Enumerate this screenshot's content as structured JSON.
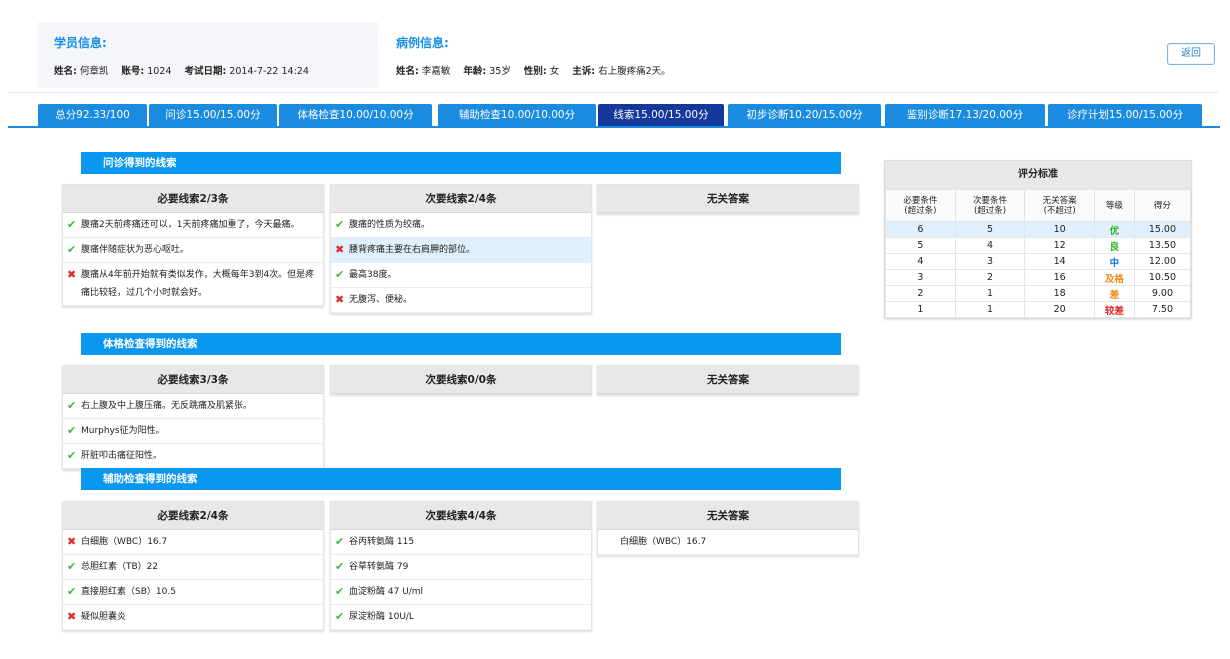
{
  "student": {
    "title": "学员信息:",
    "name_label": "姓名:",
    "name": "何章凯",
    "id_label": "账号:",
    "id": "1024",
    "date_label": "考试日期:",
    "date": "2014-7-22 14:24"
  },
  "case": {
    "title": "病例信息:",
    "name_label": "姓名:",
    "name": "李嘉敏",
    "age_label": "年龄:",
    "age": "35岁",
    "sex_label": "性别:",
    "sex": "女",
    "complaint_label": "主诉:",
    "complaint": "右上腹疼痛2天。"
  },
  "back_label": "返回",
  "tabs": [
    {
      "label": "总分92.33/100"
    },
    {
      "label": "问诊15.00/15.00分"
    },
    {
      "label": "体格检查10.00/10.00分"
    },
    {
      "label": "辅助检查10.00/10.00分"
    },
    {
      "label": "线索15.00/15.00分"
    },
    {
      "label": "初步诊断10.20/15.00分"
    },
    {
      "label": "鉴别诊断17.13/20.00分"
    },
    {
      "label": "诊疗计划15.00/15.00分"
    }
  ],
  "active_tab": 4,
  "sections": [
    {
      "title": "问诊得到的线索",
      "columns": [
        {
          "header": "必要线索2/3条",
          "rows": [
            {
              "text": "腹痛2天前疼痛还可以，1天前疼痛加重了，今天最痛。",
              "status": "ok"
            },
            {
              "text": "腹痛伴随症状为恶心呕吐。",
              "status": "ok"
            },
            {
              "text": "腹痛从4年前开始就有类似发作，大概每年3到4次。但是疼痛比较轻，过几个小时就会好。",
              "status": "bad"
            }
          ]
        },
        {
          "header": "次要线索2/4条",
          "rows": [
            {
              "text": "腹痛的性质为绞痛。",
              "status": "ok"
            },
            {
              "text": "腰背疼痛主要在右肩胛的部位。",
              "status": "bad",
              "highlight": true
            },
            {
              "text": "最高38度。",
              "status": "ok"
            },
            {
              "text": "无腹泻、便秘。",
              "status": "bad"
            }
          ]
        },
        {
          "header": "无关答案",
          "rows": []
        }
      ]
    },
    {
      "title": "体格检查得到的线索",
      "columns": [
        {
          "header": "必要线索3/3条",
          "rows": [
            {
              "text": "右上腹及中上腹压痛。无反跳痛及肌紧张。",
              "status": "ok"
            },
            {
              "text": "Murphys征为阳性。",
              "status": "ok"
            },
            {
              "text": "肝脏叩击痛征阳性。",
              "status": "ok"
            }
          ]
        },
        {
          "header": "次要线索0/0条",
          "rows": []
        },
        {
          "header": "无关答案",
          "rows": []
        }
      ]
    },
    {
      "title": "辅助检查得到的线索",
      "columns": [
        {
          "header": "必要线索2/4条",
          "rows": [
            {
              "text": "白细胞（WBC）16.7",
              "status": "bad"
            },
            {
              "text": "总胆红素（TB）22",
              "status": "ok"
            },
            {
              "text": "直接胆红素（SB）10.5",
              "status": "ok"
            },
            {
              "text": "疑似胆囊炎",
              "status": "bad"
            }
          ]
        },
        {
          "header": "次要线索4/4条",
          "rows": [
            {
              "text": "谷丙转氨酶 115",
              "status": "ok"
            },
            {
              "text": "谷草转氨酶 79",
              "status": "ok"
            },
            {
              "text": "血淀粉酶 47 U/ml",
              "status": "ok"
            },
            {
              "text": "尿淀粉酶 10U/L",
              "status": "ok"
            }
          ]
        },
        {
          "header": "无关答案",
          "rows": [
            {
              "text": "白细胞（WBC）16.7",
              "status": "none"
            }
          ]
        }
      ]
    }
  ],
  "standard": {
    "title": "评分标准",
    "headers": [
      "必要条件\n(超过条)",
      "次要条件\n(超过条)",
      "无关答案\n(不超过)",
      "等级",
      "得分"
    ],
    "rows": [
      {
        "req": "6",
        "sec": "5",
        "irr": "10",
        "grade": "优",
        "grade_color": "#2fb52f",
        "score": "15.00",
        "selected": true
      },
      {
        "req": "5",
        "sec": "4",
        "irr": "12",
        "grade": "良",
        "grade_color": "#2fb52f",
        "score": "13.50"
      },
      {
        "req": "4",
        "sec": "3",
        "irr": "14",
        "grade": "中",
        "grade_color": "#1a6fe0",
        "score": "12.00"
      },
      {
        "req": "3",
        "sec": "2",
        "irr": "16",
        "grade": "及格",
        "grade_color": "#f08a1a",
        "score": "10.50"
      },
      {
        "req": "2",
        "sec": "1",
        "irr": "18",
        "grade": "差",
        "grade_color": "#f08a1a",
        "score": "9.00"
      },
      {
        "req": "1",
        "sec": "1",
        "irr": "20",
        "grade": "较差",
        "grade_color": "#e02828",
        "score": "7.50"
      }
    ]
  }
}
